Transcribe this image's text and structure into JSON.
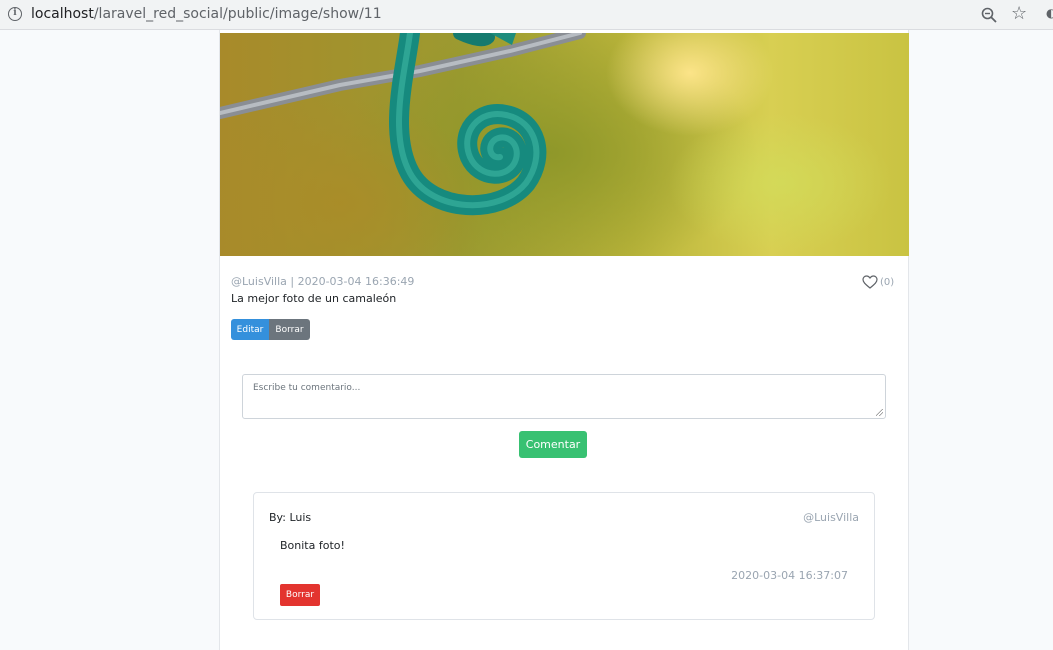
{
  "browser": {
    "url_host": "localhost",
    "url_path": "/laravel_red_social/public/image/show/11",
    "icons": [
      "info-icon",
      "zoom-icon",
      "star-icon"
    ]
  },
  "post": {
    "meta": "@LuisVilla | 2020-03-04 16:36:49",
    "likes": "(0)",
    "description": "La mejor foto de un camaleón",
    "edit_label": "Editar",
    "delete_label": "Borrar"
  },
  "comment_form": {
    "placeholder": "Escribe tu comentario...",
    "submit_label": "Comentar"
  },
  "comments": [
    {
      "by": "By: Luis",
      "handle": "@LuisVilla",
      "text": "Bonita foto!",
      "date": "2020-03-04 16:37:07",
      "delete_label": "Borrar"
    }
  ],
  "colors": {
    "primary": "#3490dc",
    "secondary": "#6c757d",
    "success": "#38c172",
    "danger": "#e3342f",
    "muted": "#9aa5b1"
  }
}
